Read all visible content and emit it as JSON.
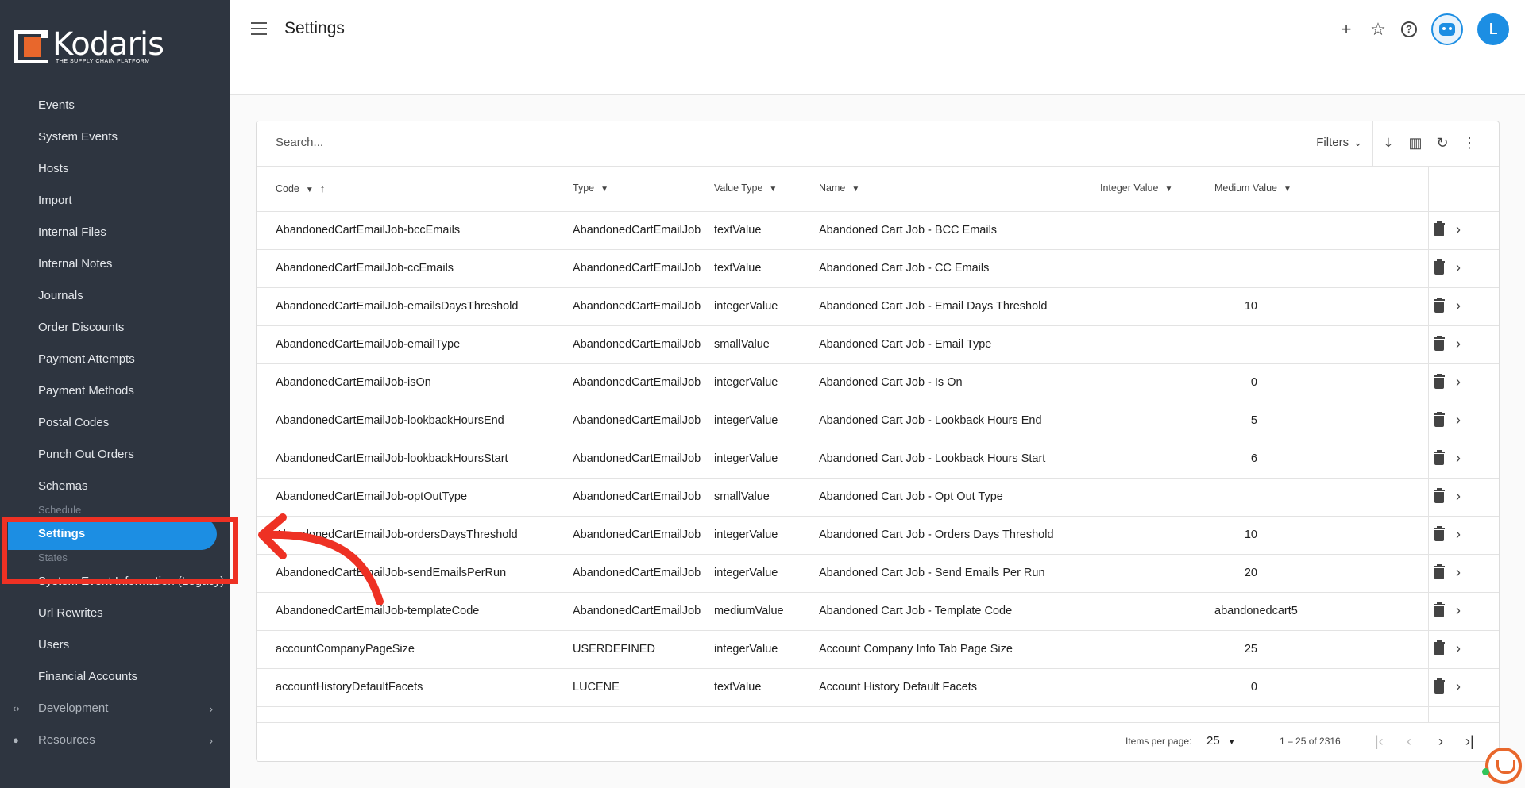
{
  "brand": {
    "name": "Kodaris",
    "tagline": "THE SUPPLY CHAIN PLATFORM"
  },
  "sidebar": {
    "items": [
      {
        "label": "Events"
      },
      {
        "label": "System Events"
      },
      {
        "label": "Hosts"
      },
      {
        "label": "Import"
      },
      {
        "label": "Internal Files"
      },
      {
        "label": "Internal Notes"
      },
      {
        "label": "Journals"
      },
      {
        "label": "Order Discounts"
      },
      {
        "label": "Payment Attempts"
      },
      {
        "label": "Payment Methods"
      },
      {
        "label": "Postal Codes"
      },
      {
        "label": "Punch Out Orders"
      },
      {
        "label": "Schemas"
      }
    ],
    "partial_above": "Schedule",
    "active": "Settings",
    "partial_below": "States",
    "items_after": [
      {
        "label": "System Event Information (Legacy)"
      },
      {
        "label": "Url Rewrites"
      },
      {
        "label": "Users"
      },
      {
        "label": "Financial Accounts"
      }
    ],
    "groups": [
      {
        "label": "Development",
        "icon": "code-icon"
      },
      {
        "label": "Resources",
        "icon": "help-circle-icon"
      }
    ]
  },
  "header": {
    "title": "Settings",
    "avatar_letter": "L"
  },
  "toolbar": {
    "search_placeholder": "Search...",
    "filters_label": "Filters"
  },
  "table": {
    "columns": {
      "code": "Code",
      "type": "Type",
      "value_type": "Value Type",
      "name": "Name",
      "integer_value": "Integer Value",
      "medium_value": "Medium Value"
    },
    "rows": [
      {
        "code": "AbandonedCartEmailJob-bccEmails",
        "type": "AbandonedCartEmailJob",
        "value_type": "textValue",
        "name": "Abandoned Cart Job - BCC Emails",
        "integer_value": "",
        "medium_value": ""
      },
      {
        "code": "AbandonedCartEmailJob-ccEmails",
        "type": "AbandonedCartEmailJob",
        "value_type": "textValue",
        "name": "Abandoned Cart Job - CC Emails",
        "integer_value": "",
        "medium_value": ""
      },
      {
        "code": "AbandonedCartEmailJob-emailsDaysThreshold",
        "type": "AbandonedCartEmailJob",
        "value_type": "integerValue",
        "name": "Abandoned Cart Job - Email Days Threshold",
        "integer_value": "10",
        "medium_value": ""
      },
      {
        "code": "AbandonedCartEmailJob-emailType",
        "type": "AbandonedCartEmailJob",
        "value_type": "smallValue",
        "name": "Abandoned Cart Job - Email Type",
        "integer_value": "",
        "medium_value": ""
      },
      {
        "code": "AbandonedCartEmailJob-isOn",
        "type": "AbandonedCartEmailJob",
        "value_type": "integerValue",
        "name": "Abandoned Cart Job - Is On",
        "integer_value": "0",
        "medium_value": ""
      },
      {
        "code": "AbandonedCartEmailJob-lookbackHoursEnd",
        "type": "AbandonedCartEmailJob",
        "value_type": "integerValue",
        "name": "Abandoned Cart Job - Lookback Hours End",
        "integer_value": "5",
        "medium_value": ""
      },
      {
        "code": "AbandonedCartEmailJob-lookbackHoursStart",
        "type": "AbandonedCartEmailJob",
        "value_type": "integerValue",
        "name": "Abandoned Cart Job - Lookback Hours Start",
        "integer_value": "6",
        "medium_value": ""
      },
      {
        "code": "AbandonedCartEmailJob-optOutType",
        "type": "AbandonedCartEmailJob",
        "value_type": "smallValue",
        "name": "Abandoned Cart Job - Opt Out Type",
        "integer_value": "",
        "medium_value": ""
      },
      {
        "code": "AbandonedCartEmailJob-ordersDaysThreshold",
        "type": "AbandonedCartEmailJob",
        "value_type": "integerValue",
        "name": "Abandoned Cart Job - Orders Days Threshold",
        "integer_value": "10",
        "medium_value": ""
      },
      {
        "code": "AbandonedCartEmailJob-sendEmailsPerRun",
        "type": "AbandonedCartEmailJob",
        "value_type": "integerValue",
        "name": "Abandoned Cart Job - Send Emails Per Run",
        "integer_value": "20",
        "medium_value": ""
      },
      {
        "code": "AbandonedCartEmailJob-templateCode",
        "type": "AbandonedCartEmailJob",
        "value_type": "mediumValue",
        "name": "Abandoned Cart Job - Template Code",
        "integer_value": "",
        "medium_value": "abandonedcart5"
      },
      {
        "code": "accountCompanyPageSize",
        "type": "USERDEFINED",
        "value_type": "integerValue",
        "name": "Account Company Info Tab Page Size",
        "integer_value": "25",
        "medium_value": ""
      },
      {
        "code": "accountHistoryDefaultFacets",
        "type": "LUCENE",
        "value_type": "textValue",
        "name": "Account History Default Facets",
        "integer_value": "0",
        "medium_value": ""
      }
    ]
  },
  "pager": {
    "items_per_page_label": "Items per page:",
    "items_per_page": "25",
    "range": "1 – 25 of 2316"
  },
  "colors": {
    "sidebar_bg": "#2e3540",
    "accent": "#1c8ee3",
    "brand_orange": "#e8672c",
    "annotation_red": "#ee3124"
  }
}
